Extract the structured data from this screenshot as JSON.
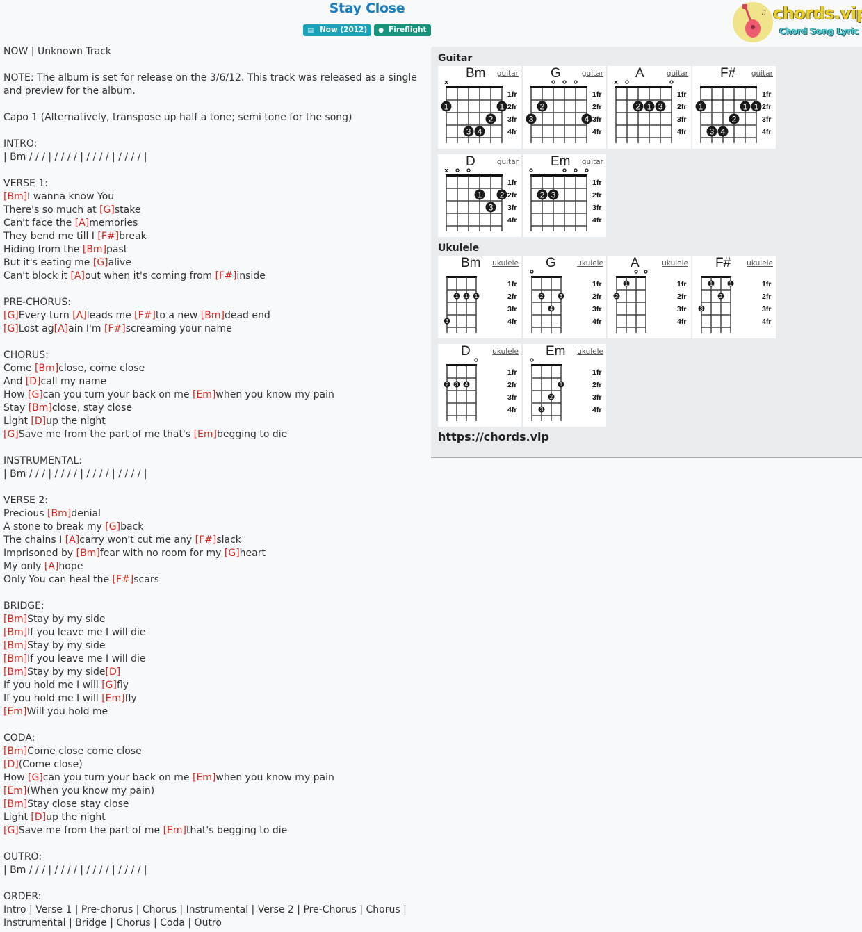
{
  "song": {
    "title": "Stay Close",
    "album_badge": "Now (2012)",
    "artist_badge": "Fireflight",
    "album_icon": "book-icon",
    "artist_icon": "user-icon"
  },
  "logo": {
    "brand": "chords.vip",
    "tagline": "Chord Song Lyric"
  },
  "lyrics": [
    [
      {
        "t": "NOW | Unknown Track"
      }
    ],
    [],
    [
      {
        "t": "NOTE: The album is set for release on the 3/6/12. This track was released as a single"
      }
    ],
    [
      {
        "t": "and preview for the album."
      }
    ],
    [],
    [
      {
        "t": "Capo 1 (Alternatively, transpose up half a tone; semi tone for the song)"
      }
    ],
    [],
    [
      {
        "t": "INTRO:"
      }
    ],
    [
      {
        "t": "| Bm / / / | / / / / | / / / / | / / / / |"
      }
    ],
    [],
    [
      {
        "t": "VERSE 1:"
      }
    ],
    [
      {
        "c": "[Bm]"
      },
      {
        "t": "I wanna know You"
      }
    ],
    [
      {
        "t": "There's so much at "
      },
      {
        "c": "[G]"
      },
      {
        "t": "stake"
      }
    ],
    [
      {
        "t": "Can't face the "
      },
      {
        "c": "[A]"
      },
      {
        "t": "memories"
      }
    ],
    [
      {
        "t": "They bend me till I "
      },
      {
        "c": "[F#]"
      },
      {
        "t": "break"
      }
    ],
    [
      {
        "t": "Hiding from the "
      },
      {
        "c": "[Bm]"
      },
      {
        "t": "past"
      }
    ],
    [
      {
        "t": "But it's eating me "
      },
      {
        "c": "[G]"
      },
      {
        "t": "alive"
      }
    ],
    [
      {
        "t": "Can't block it "
      },
      {
        "c": "[A]"
      },
      {
        "t": "out when it's coming from "
      },
      {
        "c": "[F#]"
      },
      {
        "t": "inside"
      }
    ],
    [],
    [
      {
        "t": "PRE-CHORUS:"
      }
    ],
    [
      {
        "c": "[G]"
      },
      {
        "t": "Every turn "
      },
      {
        "c": "[A]"
      },
      {
        "t": "leads me "
      },
      {
        "c": "[F#]"
      },
      {
        "t": "to a new "
      },
      {
        "c": "[Bm]"
      },
      {
        "t": "dead end"
      }
    ],
    [
      {
        "c": "[G]"
      },
      {
        "t": "Lost ag"
      },
      {
        "c": "[A]"
      },
      {
        "t": "ain I'm "
      },
      {
        "c": "[F#]"
      },
      {
        "t": "screaming your name"
      }
    ],
    [],
    [
      {
        "t": "CHORUS:"
      }
    ],
    [
      {
        "t": "Come "
      },
      {
        "c": "[Bm]"
      },
      {
        "t": "close, come close"
      }
    ],
    [
      {
        "t": "And "
      },
      {
        "c": "[D]"
      },
      {
        "t": "call my name"
      }
    ],
    [
      {
        "t": "How "
      },
      {
        "c": "[G]"
      },
      {
        "t": "can you turn your back on me "
      },
      {
        "c": "[Em]"
      },
      {
        "t": "when you know my pain"
      }
    ],
    [
      {
        "t": "Stay "
      },
      {
        "c": "[Bm]"
      },
      {
        "t": "close, stay close"
      }
    ],
    [
      {
        "t": "Light "
      },
      {
        "c": "[D]"
      },
      {
        "t": "up the night"
      }
    ],
    [
      {
        "c": "[G]"
      },
      {
        "t": "Save me from the part of me that's "
      },
      {
        "c": "[Em]"
      },
      {
        "t": "begging to die"
      }
    ],
    [],
    [
      {
        "t": "INSTRUMENTAL:"
      }
    ],
    [
      {
        "t": "| Bm / / / | / / / / | / / / / | / / / / |"
      }
    ],
    [],
    [
      {
        "t": "VERSE 2:"
      }
    ],
    [
      {
        "t": "Precious "
      },
      {
        "c": "[Bm]"
      },
      {
        "t": "denial"
      }
    ],
    [
      {
        "t": "A stone to break my "
      },
      {
        "c": "[G]"
      },
      {
        "t": "back"
      }
    ],
    [
      {
        "t": "The chains I "
      },
      {
        "c": "[A]"
      },
      {
        "t": "carry won't cut me any "
      },
      {
        "c": "[F#]"
      },
      {
        "t": "slack"
      }
    ],
    [
      {
        "t": "Imprisoned by "
      },
      {
        "c": "[Bm]"
      },
      {
        "t": "fear with no room for my "
      },
      {
        "c": "[G]"
      },
      {
        "t": "heart"
      }
    ],
    [
      {
        "t": "My only "
      },
      {
        "c": "[A]"
      },
      {
        "t": "hope"
      }
    ],
    [
      {
        "t": "Only You can heal the "
      },
      {
        "c": "[F#]"
      },
      {
        "t": "scars"
      }
    ],
    [],
    [
      {
        "t": "BRIDGE:"
      }
    ],
    [
      {
        "c": "[Bm]"
      },
      {
        "t": "Stay by my side"
      }
    ],
    [
      {
        "c": "[Bm]"
      },
      {
        "t": "If you leave me I will die"
      }
    ],
    [
      {
        "c": "[Bm]"
      },
      {
        "t": "Stay by my side"
      }
    ],
    [
      {
        "c": "[Bm]"
      },
      {
        "t": "If you leave me I will die"
      }
    ],
    [
      {
        "c": "[Bm]"
      },
      {
        "t": "Stay by my side"
      },
      {
        "c": "[D]"
      }
    ],
    [
      {
        "t": "If you hold me I will "
      },
      {
        "c": "[G]"
      },
      {
        "t": "fly"
      }
    ],
    [
      {
        "t": "If you hold me I will "
      },
      {
        "c": "[Em]"
      },
      {
        "t": "fly"
      }
    ],
    [
      {
        "c": "[Em]"
      },
      {
        "t": "Will you hold me"
      }
    ],
    [],
    [
      {
        "t": "CODA:"
      }
    ],
    [
      {
        "c": "[Bm]"
      },
      {
        "t": "Come close come close"
      }
    ],
    [
      {
        "c": "[D]"
      },
      {
        "t": "(Come close)"
      }
    ],
    [
      {
        "t": "How "
      },
      {
        "c": "[G]"
      },
      {
        "t": "can you turn your back on me "
      },
      {
        "c": "[Em]"
      },
      {
        "t": "when you know my pain"
      }
    ],
    [
      {
        "c": "[Em]"
      },
      {
        "t": "(When you know my pain)"
      }
    ],
    [
      {
        "c": "[Bm]"
      },
      {
        "t": "Stay close stay close"
      }
    ],
    [
      {
        "t": "Light "
      },
      {
        "c": "[D]"
      },
      {
        "t": "up the night"
      }
    ],
    [
      {
        "c": "[G]"
      },
      {
        "t": "Save me from the part of me "
      },
      {
        "c": "[Em]"
      },
      {
        "t": "that's begging to die"
      }
    ],
    [],
    [
      {
        "t": "OUTRO:"
      }
    ],
    [
      {
        "t": "| Bm / / / | / / / / | / / / / | / / / / |"
      }
    ],
    [],
    [
      {
        "t": "ORDER:"
      }
    ],
    [
      {
        "t": "Intro | Verse 1 | Pre-chorus | Chorus | Instrumental | Verse 2 | Pre-Chorus | Chorus |"
      }
    ],
    [
      {
        "t": "Instrumental | Bridge | Chorus | Coda | Outro"
      }
    ]
  ],
  "panel": {
    "guitar_label": "Guitar",
    "ukulele_label": "Ukulele",
    "fret_labels": [
      "1fr",
      "2fr",
      "3fr",
      "4fr"
    ],
    "site_url": "https://chords.vip",
    "guitar": [
      {
        "name": "Bm",
        "type": "guitar",
        "markers": [
          "x",
          "",
          "",
          "",
          "",
          ""
        ],
        "dots": [
          [
            1,
            2,
            "1"
          ],
          [
            6,
            2,
            "1"
          ],
          [
            5,
            3,
            "2"
          ],
          [
            3,
            4,
            "3"
          ],
          [
            4,
            4,
            "4"
          ]
        ]
      },
      {
        "name": "G",
        "type": "guitar",
        "markers": [
          "",
          "",
          "o",
          "o",
          "o",
          ""
        ],
        "dots": [
          [
            2,
            2,
            "2"
          ],
          [
            1,
            3,
            "3"
          ],
          [
            6,
            3,
            "4"
          ]
        ]
      },
      {
        "name": "A",
        "type": "guitar",
        "markers": [
          "x",
          "o",
          "",
          "",
          "",
          "o"
        ],
        "dots": [
          [
            3,
            2,
            "2"
          ],
          [
            4,
            2,
            "1"
          ],
          [
            5,
            2,
            "3"
          ]
        ]
      },
      {
        "name": "F#",
        "type": "guitar",
        "markers": [
          "",
          "",
          "",
          "",
          "",
          ""
        ],
        "dots": [
          [
            1,
            2,
            "1"
          ],
          [
            5,
            2,
            "1"
          ],
          [
            6,
            2,
            "1"
          ],
          [
            4,
            3,
            "2"
          ],
          [
            2,
            4,
            "3"
          ],
          [
            3,
            4,
            "4"
          ]
        ]
      },
      {
        "name": "D",
        "type": "guitar",
        "markers": [
          "x",
          "o",
          "o",
          "",
          "",
          ""
        ],
        "dots": [
          [
            4,
            2,
            "1"
          ],
          [
            6,
            2,
            "2"
          ],
          [
            5,
            3,
            "3"
          ]
        ]
      },
      {
        "name": "Em",
        "type": "guitar",
        "markers": [
          "o",
          "",
          "",
          "o",
          "o",
          "o"
        ],
        "dots": [
          [
            2,
            2,
            "2"
          ],
          [
            3,
            2,
            "3"
          ]
        ]
      }
    ],
    "ukulele": [
      {
        "name": "Bm",
        "type": "ukulele",
        "markers": [
          "",
          "",
          "",
          ""
        ],
        "dots": [
          [
            2,
            2,
            "1"
          ],
          [
            3,
            2,
            "1"
          ],
          [
            4,
            2,
            "1"
          ],
          [
            1,
            4,
            "3"
          ]
        ]
      },
      {
        "name": "G",
        "type": "ukulele",
        "markers": [
          "o",
          "",
          "",
          ""
        ],
        "dots": [
          [
            2,
            2,
            "2"
          ],
          [
            4,
            2,
            "3"
          ],
          [
            3,
            3,
            "4"
          ]
        ]
      },
      {
        "name": "A",
        "type": "ukulele",
        "markers": [
          "",
          "",
          "o",
          "o"
        ],
        "dots": [
          [
            2,
            1,
            "1"
          ],
          [
            1,
            2,
            "2"
          ]
        ]
      },
      {
        "name": "F#",
        "type": "ukulele",
        "markers": [
          "",
          "",
          "",
          ""
        ],
        "dots": [
          [
            2,
            1,
            "1"
          ],
          [
            4,
            1,
            "1"
          ],
          [
            3,
            2,
            "2"
          ],
          [
            1,
            3,
            "3"
          ]
        ]
      },
      {
        "name": "D",
        "type": "ukulele",
        "markers": [
          "",
          "",
          "",
          "o"
        ],
        "dots": [
          [
            1,
            2,
            "2"
          ],
          [
            2,
            2,
            "3"
          ],
          [
            3,
            2,
            "4"
          ]
        ]
      },
      {
        "name": "Em",
        "type": "ukulele",
        "markers": [
          "o",
          "",
          "",
          ""
        ],
        "dots": [
          [
            4,
            2,
            "1"
          ],
          [
            3,
            3,
            "2"
          ],
          [
            2,
            4,
            "3"
          ]
        ]
      }
    ]
  }
}
